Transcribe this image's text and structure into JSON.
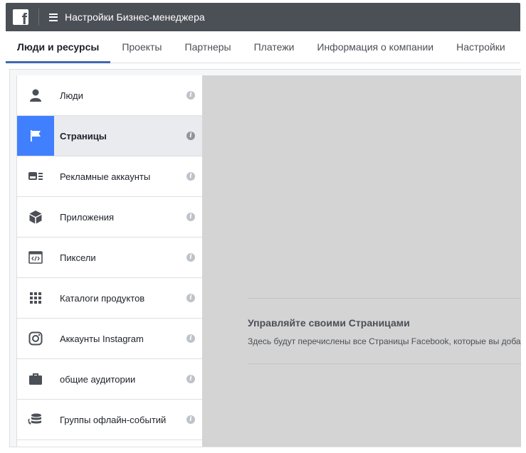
{
  "topbar": {
    "logo_letter": "f",
    "title": "Настройки Бизнес-менеджера"
  },
  "tabs": [
    {
      "label": "Люди и ресурсы",
      "active": true
    },
    {
      "label": "Проекты"
    },
    {
      "label": "Партнеры"
    },
    {
      "label": "Платежи"
    },
    {
      "label": "Информация о компании"
    },
    {
      "label": "Настройки"
    }
  ],
  "sidebar": {
    "items": [
      {
        "label": "Люди",
        "icon": "person-icon"
      },
      {
        "label": "Страницы",
        "icon": "flag-icon",
        "active": true
      },
      {
        "label": "Рекламные аккаунты",
        "icon": "ad-account-icon"
      },
      {
        "label": "Приложения",
        "icon": "cube-icon"
      },
      {
        "label": "Пиксели",
        "icon": "code-window-icon"
      },
      {
        "label": "Каталоги продуктов",
        "icon": "grid-icon"
      },
      {
        "label": "Аккаунты Instagram",
        "icon": "instagram-icon"
      },
      {
        "label": "общие аудитории",
        "icon": "briefcase-icon"
      },
      {
        "label": "Группы офлайн-событий",
        "icon": "database-sync-icon"
      }
    ],
    "info_glyph": "i"
  },
  "empty_state": {
    "title": "Управляйте своими Страницами",
    "description": "Здесь будут перечислены все Страницы Facebook, которые вы доба"
  },
  "colors": {
    "topbar": "#4b4f56",
    "accent": "#4267b2",
    "active_icon_bg": "#4080ff",
    "content_bg": "#d4d4d4"
  }
}
